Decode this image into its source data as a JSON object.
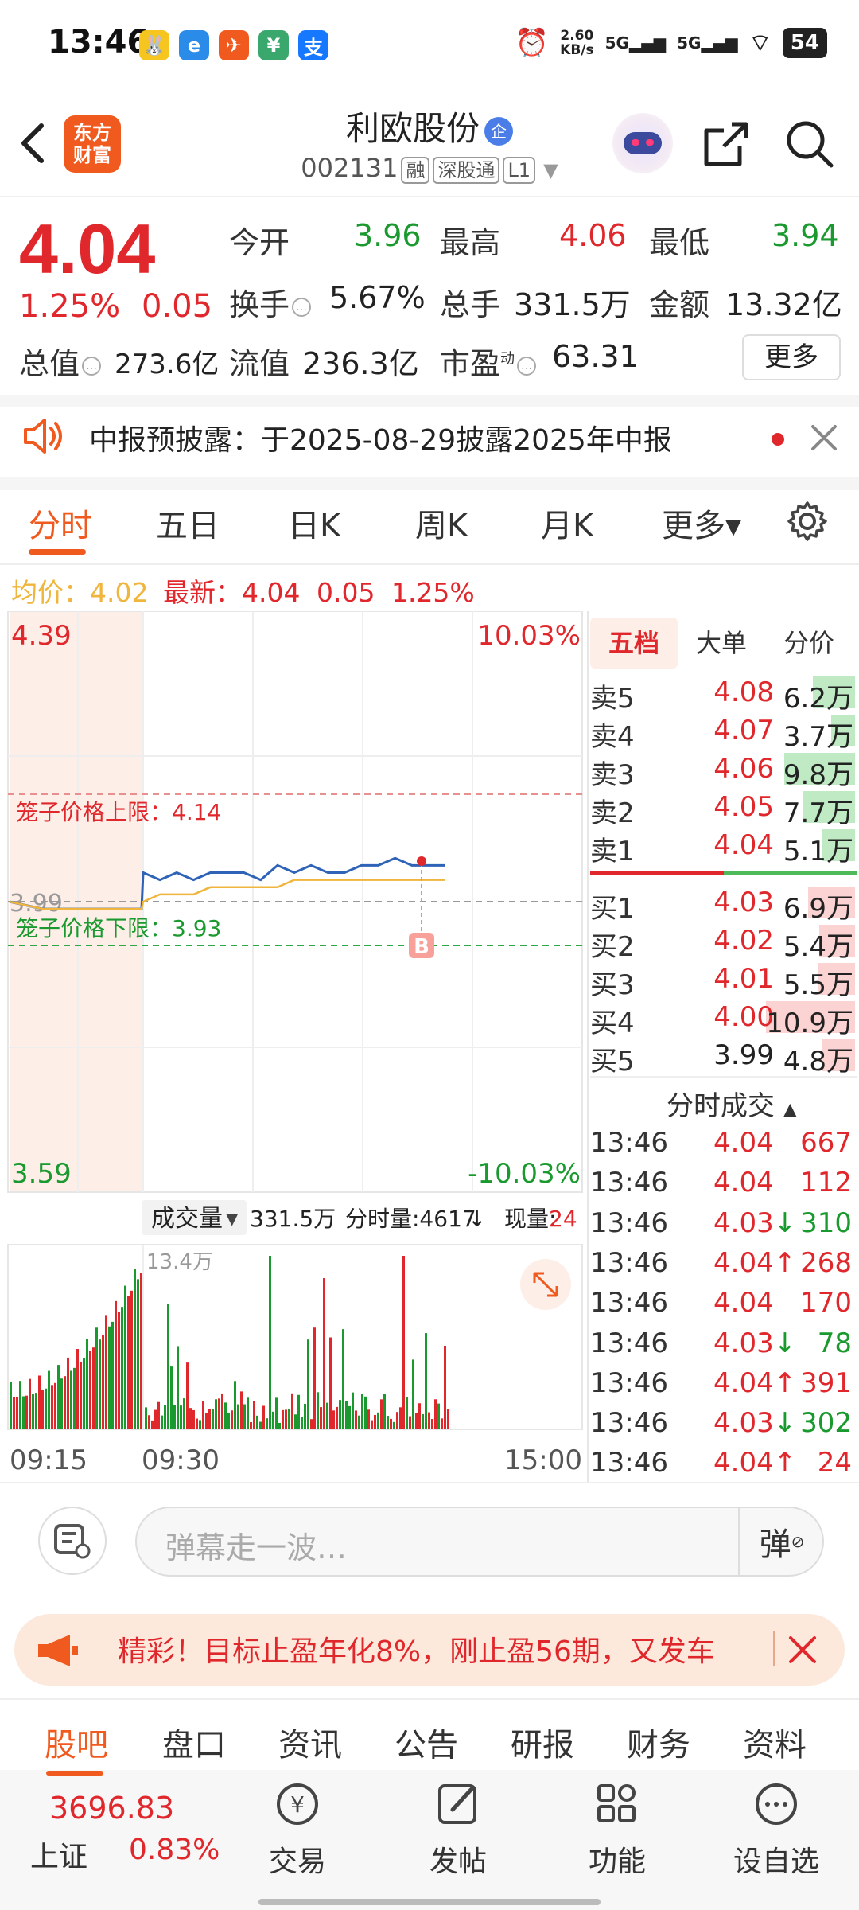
{
  "status_bar": {
    "time": "13:46",
    "speed": "2.60",
    "speed_unit": "KB/s",
    "net1": "5G",
    "net2": "5G",
    "battery": "54"
  },
  "header": {
    "logo_line1": "东方",
    "logo_line2": "财富",
    "title": "利欧股份",
    "title_badge": "企",
    "code": "002131",
    "tags": [
      "融",
      "深股通",
      "L1"
    ]
  },
  "quote": {
    "price": "4.04",
    "change_pct": "1.25%",
    "change": "0.05",
    "open_label": "今开",
    "open": "3.96",
    "high_label": "最高",
    "high": "4.06",
    "low_label": "最低",
    "low": "3.94",
    "turnover_label": "换手",
    "turnover": "5.67%",
    "volume_label": "总手",
    "volume": "331.5万",
    "amount_label": "金额",
    "amount": "13.32亿",
    "mktcap_label": "总值",
    "mktcap": "273.6亿",
    "float_label": "流值",
    "float": "236.3亿",
    "pe_label": "市盈",
    "pe_sup": "动",
    "pe": "63.31",
    "more_label": "更多"
  },
  "notice": {
    "text": "中报预披露：于2025-08-29披露2025年中报"
  },
  "tabs": [
    {
      "label": "分时",
      "active": true
    },
    {
      "label": "五日"
    },
    {
      "label": "日K"
    },
    {
      "label": "周K"
    },
    {
      "label": "月K"
    },
    {
      "label": "更多▾"
    }
  ],
  "info_line": {
    "avg_label": "均价：",
    "avg": "4.02",
    "latest_label": "最新：",
    "latest": "4.04",
    "chg": "0.05",
    "pct": "1.25%"
  },
  "chart": {
    "y_top": "4.39",
    "y_bottom": "3.59",
    "pct_top": "10.03%",
    "pct_bottom": "-10.03%",
    "y_mid": "3.99",
    "upper_limit_label": "笼子价格上限：4.14",
    "lower_limit_label": "笼子价格下限：3.93",
    "marker": "B",
    "vol_label": "成交量",
    "vol_total": "331.5万",
    "vol_min_label": "分时量:4617",
    "vol_now_label": "现量:",
    "vol_now": "24",
    "vol_scale": "13.4万",
    "x_start": "09:15",
    "x_open": "09:30",
    "x_end": "15:00"
  },
  "chart_data": {
    "type": "line",
    "title": "",
    "series": [
      {
        "values": [
          3.99,
          3.98,
          3.98,
          3.98,
          3.98,
          4.03,
          4.02,
          4.03,
          4.02,
          4.03,
          4.03,
          4.03,
          4.02,
          4.04,
          4.03,
          4.04,
          4.03,
          4.03,
          4.04,
          4.04,
          4.05,
          4.04,
          4.04,
          4.04
        ]
      },
      {
        "values": [
          3.99,
          3.98,
          3.98,
          3.98,
          3.98,
          3.99,
          4.0,
          4.0,
          4.0,
          4.01,
          4.01,
          4.01,
          4.01,
          4.01,
          4.02,
          4.02,
          4.02,
          4.02,
          4.02,
          4.02,
          4.02,
          4.02,
          4.02,
          4.02
        ]
      }
    ],
    "ylim": [
      3.59,
      4.39
    ],
    "x_ticks": [
      "09:15",
      "09:30",
      "15:00"
    ]
  },
  "order_book": {
    "tabs": [
      "五档",
      "大单",
      "分价"
    ],
    "asks": [
      {
        "label": "卖5",
        "price": "4.08",
        "vol": "6.2万",
        "fill": 0.45
      },
      {
        "label": "卖4",
        "price": "4.07",
        "vol": "3.7万",
        "fill": 0.25
      },
      {
        "label": "卖3",
        "price": "4.06",
        "vol": "9.8万",
        "fill": 0.75
      },
      {
        "label": "卖2",
        "price": "4.05",
        "vol": "7.7万",
        "fill": 0.55
      },
      {
        "label": "卖1",
        "price": "4.04",
        "vol": "5.1万",
        "fill": 0.35
      }
    ],
    "bids": [
      {
        "label": "买1",
        "price": "4.03",
        "vol": "6.9万",
        "fill": 0.5
      },
      {
        "label": "买2",
        "price": "4.02",
        "vol": "5.4万",
        "fill": 0.38
      },
      {
        "label": "买3",
        "price": "4.01",
        "vol": "5.5万",
        "fill": 0.4
      },
      {
        "label": "买4",
        "price": "4.00",
        "vol": "10.9万",
        "fill": 0.95
      },
      {
        "label": "买5",
        "price": "3.99",
        "vol": "4.8万",
        "fill": 0.35
      }
    ],
    "trades_header": "分时成交",
    "trades": [
      {
        "time": "13:46",
        "price": "4.04",
        "dir": "",
        "vol": "667",
        "vc": "red"
      },
      {
        "time": "13:46",
        "price": "4.04",
        "dir": "",
        "vol": "112",
        "vc": "red"
      },
      {
        "time": "13:46",
        "price": "4.03",
        "dir": "↓",
        "vol": "310",
        "vc": "green"
      },
      {
        "time": "13:46",
        "price": "4.04",
        "dir": "↑",
        "vol": "268",
        "vc": "red"
      },
      {
        "time": "13:46",
        "price": "4.04",
        "dir": "",
        "vol": "170",
        "vc": "red"
      },
      {
        "time": "13:46",
        "price": "4.03",
        "dir": "↓",
        "vol": "78",
        "vc": "green"
      },
      {
        "time": "13:46",
        "price": "4.04",
        "dir": "↑",
        "vol": "391",
        "vc": "red"
      },
      {
        "time": "13:46",
        "price": "4.03",
        "dir": "↓",
        "vol": "302",
        "vc": "green"
      },
      {
        "time": "13:46",
        "price": "4.04",
        "dir": "↑",
        "vol": "24",
        "vc": "red"
      }
    ]
  },
  "danmu": {
    "placeholder": "弹幕走一波…",
    "btn": "弹"
  },
  "ad": {
    "text": "精彩！目标止盈年化8%，刚止盈56期，又发车"
  },
  "bottom_tabs": [
    "股吧",
    "盘口",
    "资讯",
    "公告",
    "研报",
    "财务",
    "资料"
  ],
  "bottom_nav": {
    "index_value": "3696.83",
    "index_name": "上证",
    "index_change": "0.83%",
    "items": [
      "交易",
      "发帖",
      "功能",
      "设自选"
    ]
  },
  "colors": {
    "up": "#e0272c",
    "down": "#1a9a2e",
    "accent": "#f05a1e",
    "line": "#2e63b8",
    "avg": "#f0b53c"
  }
}
